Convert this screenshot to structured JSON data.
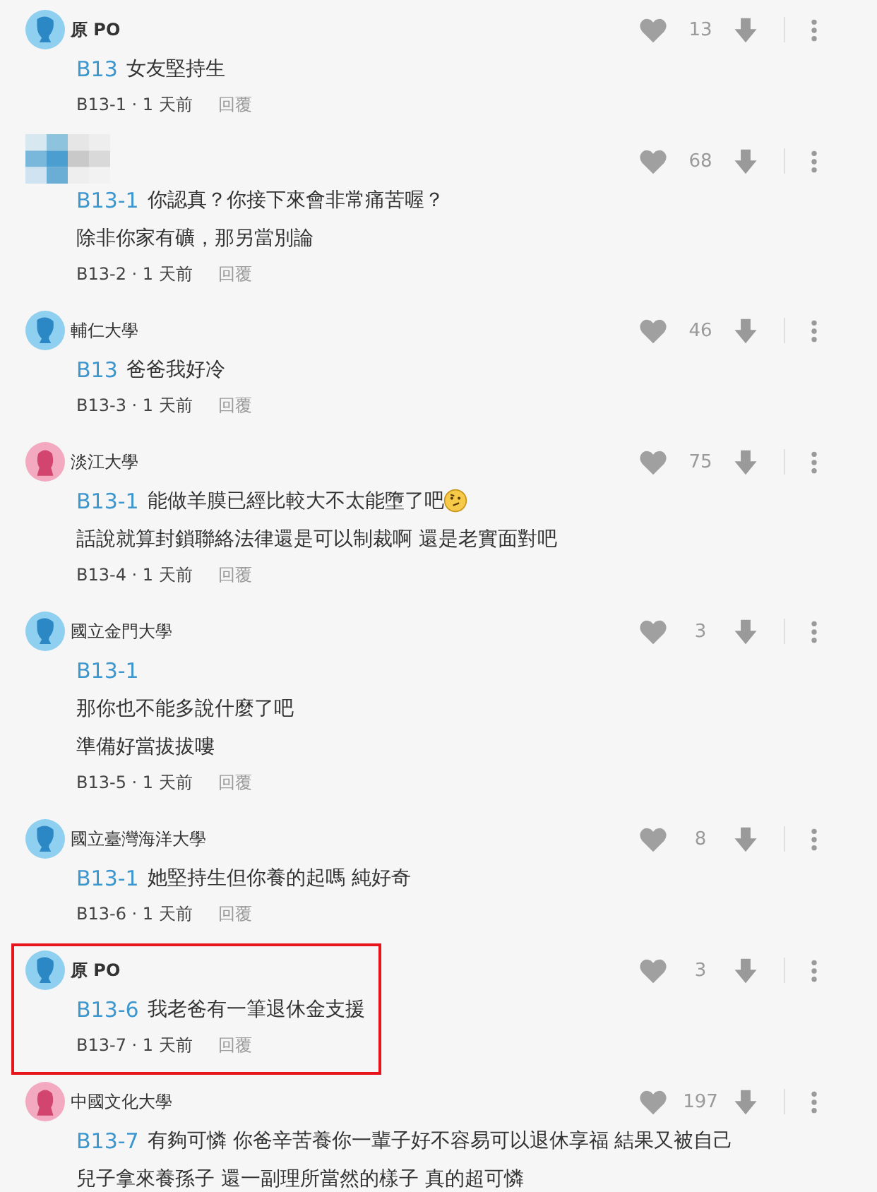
{
  "comments": [
    {
      "kind": "op",
      "author": "原 PO",
      "avatar": {
        "kind": "male"
      },
      "highlighted": false,
      "likes": "13",
      "reply_to": "B13",
      "lines": [
        "女友堅持生"
      ],
      "meta": "B13-1 · 1 天前",
      "reply": "回覆"
    },
    {
      "kind": "hidden",
      "highlighted": false,
      "likes": "68",
      "reply_to": "B13-1",
      "lines": [
        "你認真？你接下來會非常痛苦喔？",
        "除非你家有礦，那另當別論"
      ],
      "meta": "B13-2 · 1 天前",
      "reply": "回覆"
    },
    {
      "kind": "school",
      "author": "輔仁大學",
      "avatar": {
        "kind": "male"
      },
      "highlighted": false,
      "likes": "46",
      "reply_to": "B13",
      "lines": [
        "爸爸我好冷"
      ],
      "meta": "B13-3 · 1 天前",
      "reply": "回覆"
    },
    {
      "kind": "school",
      "author": "淡江大學",
      "avatar": {
        "kind": "female"
      },
      "highlighted": false,
      "likes": "75",
      "reply_to": "B13-1",
      "lines": [
        "能做羊膜已經比較大不太能墮了吧",
        "話說就算封鎖聯絡法律還是可以制裁啊 還是老實面對吧"
      ],
      "emoji": true,
      "meta": "B13-4 · 1 天前",
      "reply": "回覆"
    },
    {
      "kind": "school",
      "author": "國立金門大學",
      "avatar": {
        "kind": "male"
      },
      "highlighted": false,
      "likes": "3",
      "reply_to": "B13-1",
      "reply_to_alone": true,
      "lines": [
        "那你也不能多說什麼了吧",
        "準備好當拔拔嘍"
      ],
      "meta": "B13-5 · 1 天前",
      "reply": "回覆"
    },
    {
      "kind": "school",
      "author": "國立臺灣海洋大學",
      "avatar": {
        "kind": "male"
      },
      "highlighted": false,
      "likes": "8",
      "reply_to": "B13-1",
      "lines": [
        "她堅持生但你養的起嗎 純好奇"
      ],
      "meta": "B13-6 · 1 天前",
      "reply": "回覆"
    },
    {
      "kind": "op",
      "author": "原 PO",
      "avatar": {
        "kind": "male"
      },
      "highlighted": true,
      "likes": "3",
      "reply_to": "B13-6",
      "lines": [
        "我老爸有一筆退休金支援"
      ],
      "meta": "B13-7 · 1 天前",
      "reply": "回覆"
    },
    {
      "kind": "school",
      "author": "中國文化大學",
      "avatar": {
        "kind": "female"
      },
      "highlighted": false,
      "likes": "197",
      "reply_to": "B13-7",
      "lines": [
        "有夠可憐 你爸辛苦養你一輩子好不容易可以退休享福 結果又被自己",
        "兒子拿來養孫子 還一副理所當然的樣子 真的超可憐"
      ]
    }
  ]
}
